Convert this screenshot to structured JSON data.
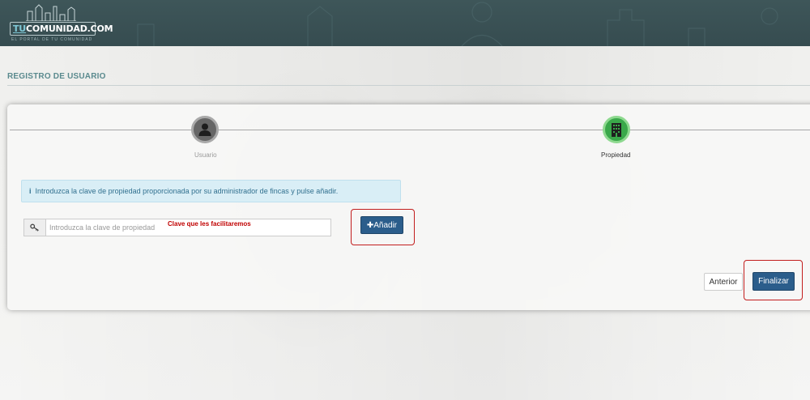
{
  "header": {
    "logo_prefix": "TU",
    "logo_main": "COMUNIDAD.COM",
    "logo_tagline": "EL PORTAL DE TU COMUNIDAD",
    "bg_color": "#3b5256"
  },
  "page": {
    "title": "REGISTRO DE USUARIO"
  },
  "wizard": {
    "steps": [
      {
        "label": "Usuario",
        "icon": "user-icon",
        "state": "completed",
        "color": "#666666"
      },
      {
        "label": "Propiedad",
        "icon": "building-icon",
        "state": "active",
        "color": "#3aa84a"
      }
    ]
  },
  "info": {
    "icon": "info-icon",
    "icon_glyph": "i",
    "text": "Introduzca la clave de propiedad proporcionada por su administrador de fincas y pulse añadir."
  },
  "form": {
    "key_icon": "key-icon",
    "key_placeholder": "Introduzca la clave de propiedad",
    "key_value": "",
    "annotation": "Clave que les facilitaremos",
    "add_label": "Añadir",
    "add_icon_glyph": "✚"
  },
  "footer": {
    "prev_label": "Anterior",
    "finish_label": "Finalizar"
  },
  "colors": {
    "accent": "#2b5d8b",
    "title": "#5a8a8e",
    "annotation": "#c00000",
    "highlight": "#c21d1d"
  }
}
